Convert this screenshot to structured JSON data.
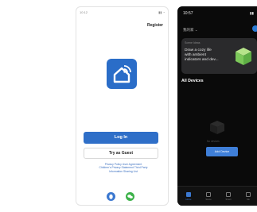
{
  "light_screen": {
    "status_time": "10:12",
    "register_label": "Register",
    "login_label": "Log In",
    "guest_label": "Try as Guest",
    "policy_lines": [
      "Privacy Policy   User Agreement",
      "Children's Privacy Statement   Third Party",
      "Information Sharing List"
    ]
  },
  "dark_screen": {
    "status_time": "10:57",
    "home_selector": "我的家 ⌄",
    "banner_kicker": "Scene Ideas",
    "banner_lines": [
      "Draw a cozy life",
      "with ambient",
      "indicators and dev..."
    ],
    "all_devices_label": "All Devices",
    "no_devices_label": "No devices",
    "add_device_label": "Add Device",
    "nav": [
      {
        "label": "Home",
        "icon": "home-icon"
      },
      {
        "label": "Scene",
        "icon": "scene-icon"
      },
      {
        "label": "Smart",
        "icon": "smart-icon"
      },
      {
        "label": "Me",
        "icon": "profile-icon"
      }
    ]
  },
  "colors": {
    "accent_blue": "#2f6fc8",
    "dark_bg": "#0a0a0a",
    "banner_bg": "#2a2a2c",
    "wechat_green": "#3db24a"
  }
}
